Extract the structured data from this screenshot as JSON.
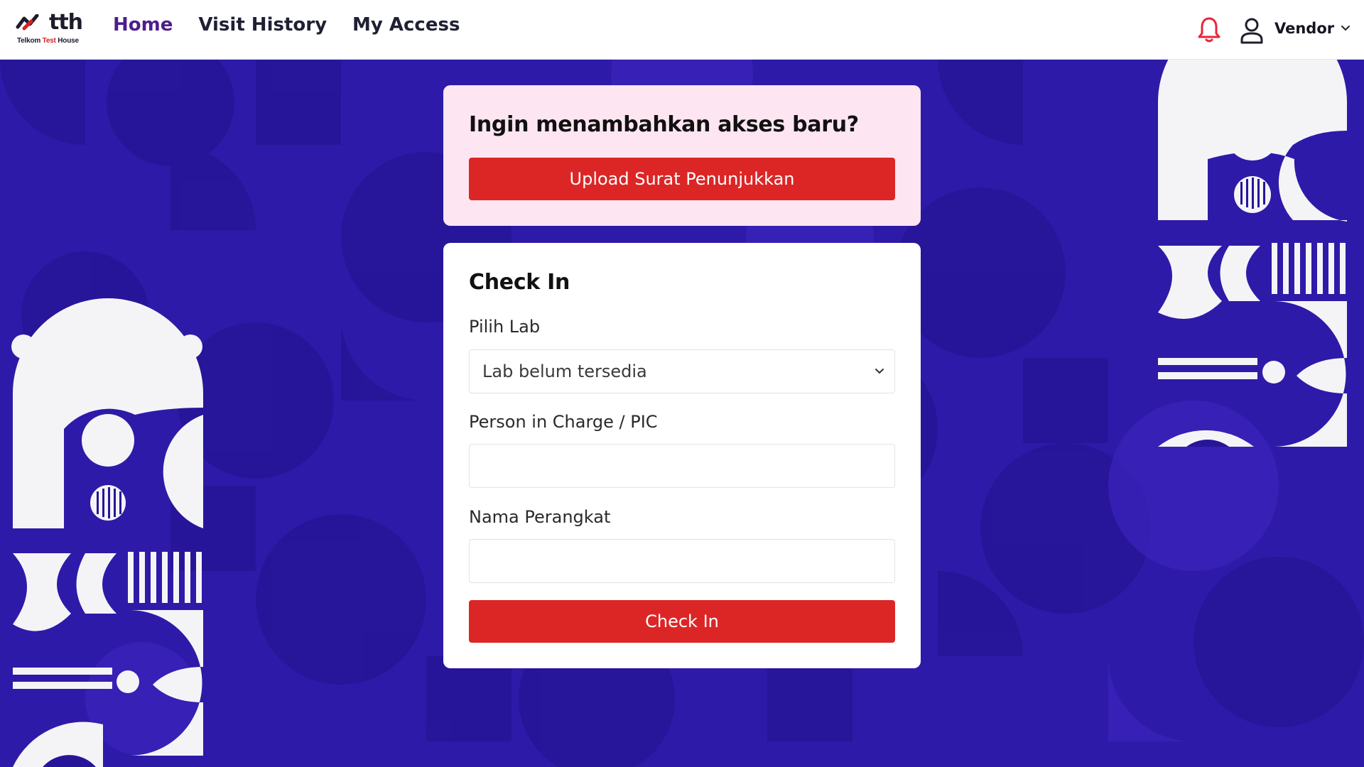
{
  "header": {
    "logo_text": "tth",
    "logo_sub_prefix": "Telkom ",
    "logo_sub_red": "Test",
    "logo_sub_suffix": " House",
    "nav": [
      {
        "label": "Home",
        "active": true
      },
      {
        "label": "Visit History",
        "active": false
      },
      {
        "label": "My Access",
        "active": false
      }
    ],
    "bell_icon": "bell-icon",
    "user_icon": "user-icon",
    "user_name": "Vendor",
    "user_menu_icon": "chevron-down-icon"
  },
  "access_card": {
    "title": "Ingin menambahkan akses baru?",
    "button_label": "Upload Surat Penunjukkan"
  },
  "checkin_card": {
    "title": "Check In",
    "lab_label": "Pilih Lab",
    "lab_selected": "Lab belum tersedia",
    "pic_label": "Person in Charge / PIC",
    "pic_value": "",
    "device_label": "Nama Perangkat",
    "device_value": "",
    "button_label": "Check In"
  },
  "colors": {
    "background": "#2e1aa8",
    "accent_red": "#dc2626",
    "nav_active": "#4d1d8c",
    "access_card_bg": "#fde5f1"
  }
}
